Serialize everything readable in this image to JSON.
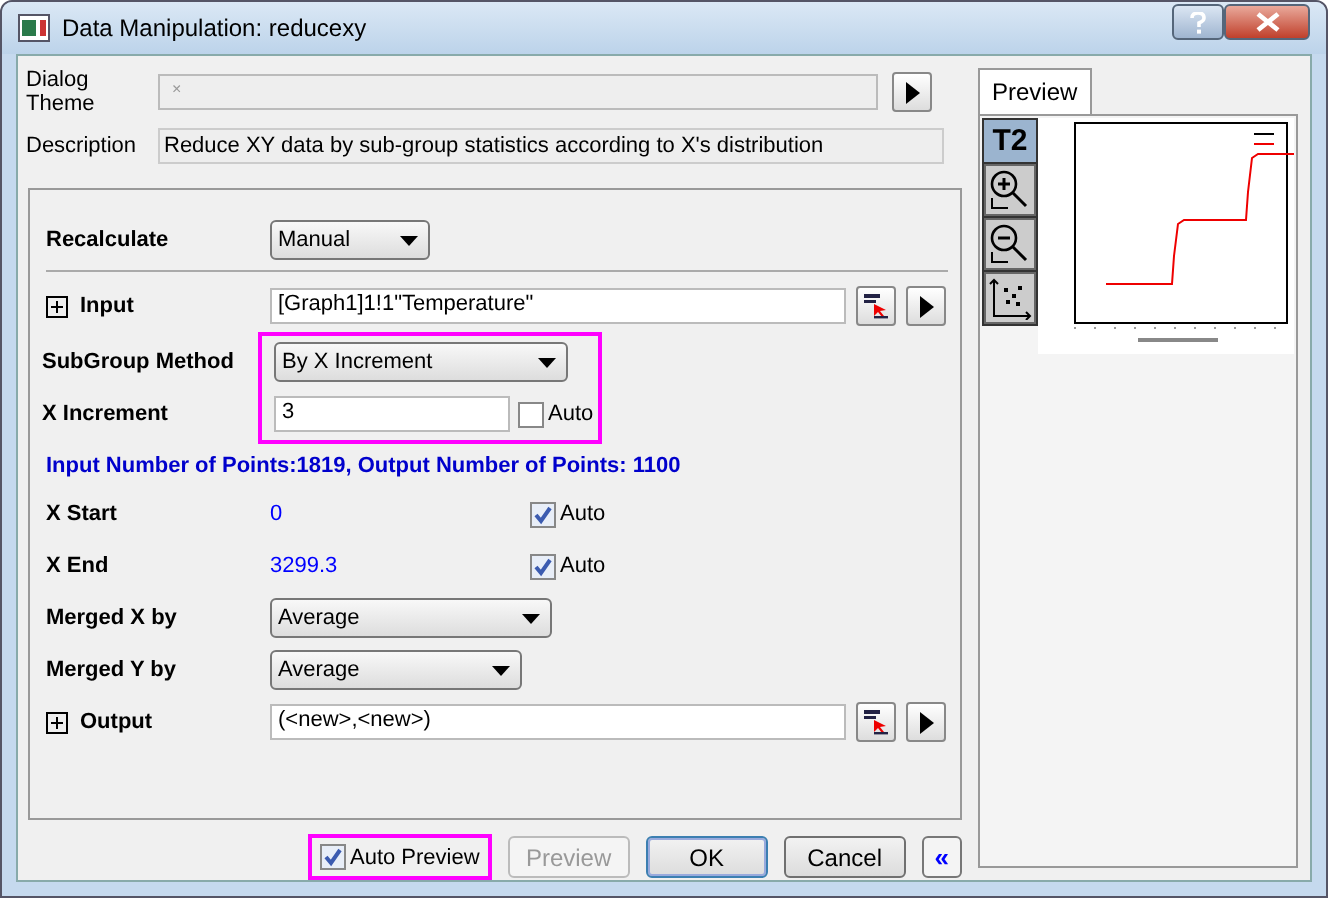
{
  "window": {
    "title": "Data Manipulation: reducexy"
  },
  "dialog_theme": {
    "label": "Dialog Theme",
    "value": "×"
  },
  "description": {
    "label": "Description",
    "value": "Reduce XY data by sub-group statistics according to X's distribution"
  },
  "rows": [
    {
      "kind": "dropdown",
      "label": "Recalculate",
      "value": "Manual"
    },
    {
      "kind": "separator"
    },
    {
      "kind": "expander",
      "label": "Input",
      "value": "[Graph1]1!1\"Temperature\"",
      "expanded": false
    },
    {
      "kind": "group",
      "highlighted": true,
      "rows": [
        {
          "kind": "dropdown",
          "label": "SubGroup Method",
          "value": "By X Increment"
        },
        {
          "kind": "text",
          "label": "X Increment",
          "value": "3",
          "auto_label": "Auto",
          "checked": false
        }
      ]
    },
    {
      "kind": "info",
      "text": "Input Number of Points:1819, Output Number of Points: 1100"
    },
    {
      "kind": "value",
      "label": "X Start",
      "value": "0",
      "auto_label": "Auto",
      "checked": true
    },
    {
      "kind": "value",
      "label": "X End",
      "value": "3299.3",
      "auto_label": "Auto",
      "checked": true
    },
    {
      "kind": "dropdown",
      "label": "Merged X by",
      "value": "Average"
    },
    {
      "kind": "dropdown",
      "label": "Merged Y by",
      "value": "Average"
    },
    {
      "kind": "expander",
      "label": "Output",
      "value": "(<new>,<new>)",
      "expanded": false
    }
  ],
  "footer": {
    "auto_preview": {
      "label": "Auto Preview",
      "checked": true,
      "highlighted": true
    },
    "buttons": [
      {
        "label": "Preview",
        "disabled": true,
        "default": false
      },
      {
        "label": "OK",
        "disabled": false,
        "default": true
      },
      {
        "label": "Cancel",
        "disabled": false,
        "default": false
      }
    ],
    "collapse": "«"
  },
  "preview": {
    "tabs": [
      {
        "label": "Preview",
        "selected": true
      }
    ],
    "toolbar_label": "T2"
  }
}
